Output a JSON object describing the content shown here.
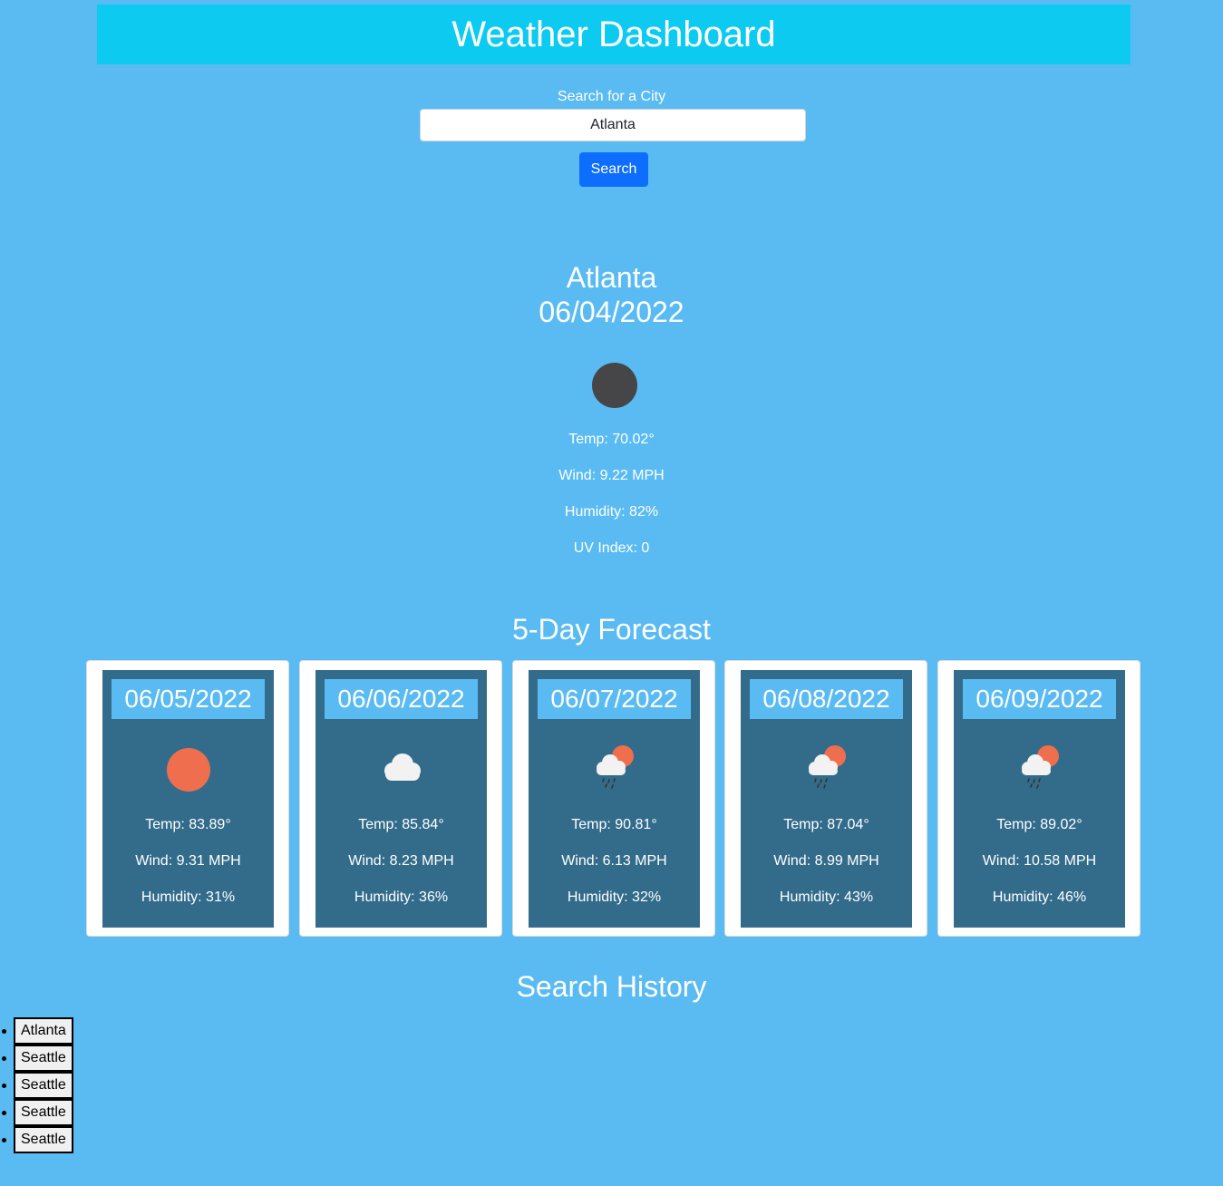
{
  "header": {
    "title": "Weather Dashboard"
  },
  "search": {
    "label": "Search for a City",
    "value": "Atlanta",
    "button_label": "Search"
  },
  "current": {
    "city": "Atlanta",
    "date": "06/04/2022",
    "icon": "moon-icon",
    "temp": "Temp: 70.02°",
    "wind": "Wind: 9.22 MPH",
    "humidity": "Humidity: 82%",
    "uv": "UV Index: 0"
  },
  "forecast": {
    "title": "5-Day Forecast",
    "days": [
      {
        "date": "06/05/2022",
        "icon": "sun-icon",
        "temp": "Temp: 83.89°",
        "wind": "Wind: 9.31 MPH",
        "humidity": "Humidity: 31%"
      },
      {
        "date": "06/06/2022",
        "icon": "cloud-icon",
        "temp": "Temp: 85.84°",
        "wind": "Wind: 8.23 MPH",
        "humidity": "Humidity: 36%"
      },
      {
        "date": "06/07/2022",
        "icon": "sun-rain-cloud-icon",
        "temp": "Temp: 90.81°",
        "wind": "Wind: 6.13 MPH",
        "humidity": "Humidity: 32%"
      },
      {
        "date": "06/08/2022",
        "icon": "sun-rain-cloud-icon",
        "temp": "Temp: 87.04°",
        "wind": "Wind: 8.99 MPH",
        "humidity": "Humidity: 43%"
      },
      {
        "date": "06/09/2022",
        "icon": "sun-rain-cloud-icon",
        "temp": "Temp: 89.02°",
        "wind": "Wind: 10.58 MPH",
        "humidity": "Humidity: 46%"
      }
    ]
  },
  "history": {
    "title": "Search History",
    "items": [
      "Atlanta",
      "Seattle",
      "Seattle",
      "Seattle",
      "Seattle"
    ]
  },
  "colors": {
    "background": "#5abbf3",
    "header": "#0dcbf0",
    "button": "#0d6efd",
    "card_inner": "#336c8b",
    "sun": "#ee6e4e",
    "moon": "#464648"
  }
}
